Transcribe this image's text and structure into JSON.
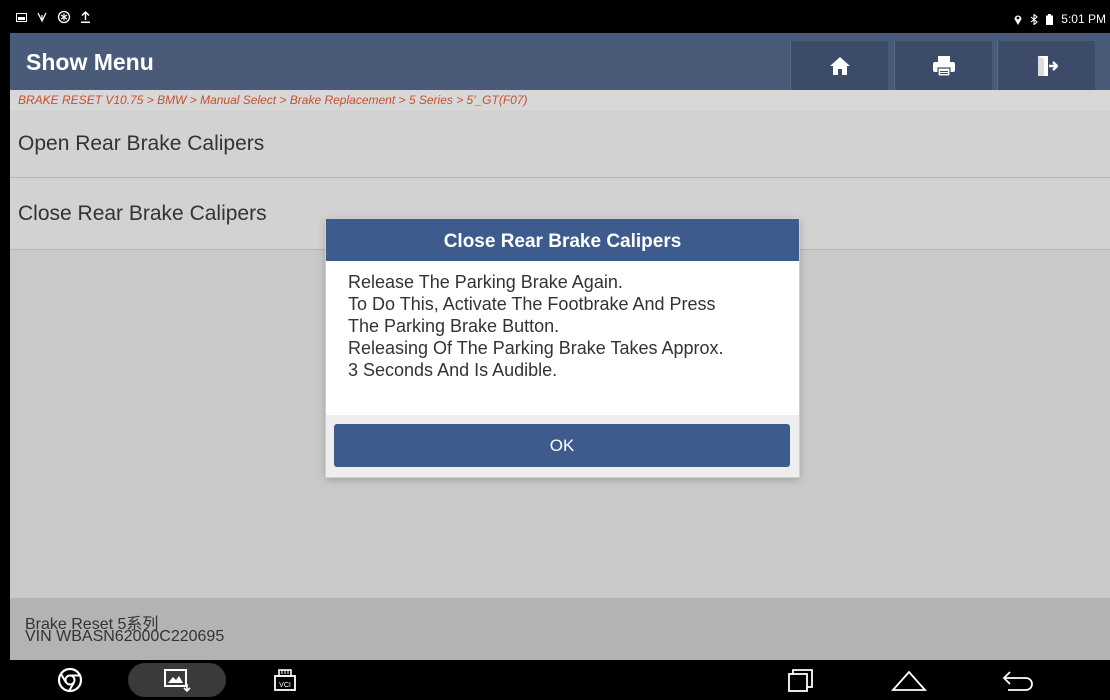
{
  "status_bar": {
    "time": "5:01 PM",
    "left_icons": [
      "gallery-icon",
      "usb-icon",
      "settings-icon",
      "upload-icon"
    ],
    "right_icons": [
      "location-icon",
      "bluetooth-icon",
      "battery-icon"
    ]
  },
  "header": {
    "title": "Show Menu",
    "buttons": [
      "home-icon",
      "print-icon",
      "exit-icon"
    ]
  },
  "breadcrumb": "BRAKE RESET V10.75 > BMW > Manual Select > Brake Replacement > 5 Series > 5'_GT(F07)",
  "menu": {
    "items": [
      {
        "label": "Open Rear Brake Calipers"
      },
      {
        "label": "Close Rear Brake Calipers"
      }
    ]
  },
  "dialog": {
    "title": "Close Rear Brake Calipers",
    "lines": [
      "Release The Parking Brake Again.",
      "To Do This, Activate The Footbrake And Press",
      "The Parking Brake Button.",
      "Releasing Of The Parking Brake Takes Approx.",
      "3 Seconds And Is Audible."
    ],
    "ok_label": "OK"
  },
  "footer": {
    "line1": "Brake Reset 5系列",
    "line2": "VIN WBASN62000C220695"
  },
  "navbar": {
    "vci_label": "VCI",
    "icons": [
      "chrome-icon",
      "screenshot-icon",
      "vci-icon",
      "recents-icon",
      "home-nav-icon",
      "back-icon"
    ]
  },
  "colors": {
    "header": "#4a5b79",
    "dialog_accent": "#3d5b8c",
    "breadcrumb_text": "#c6502c"
  }
}
